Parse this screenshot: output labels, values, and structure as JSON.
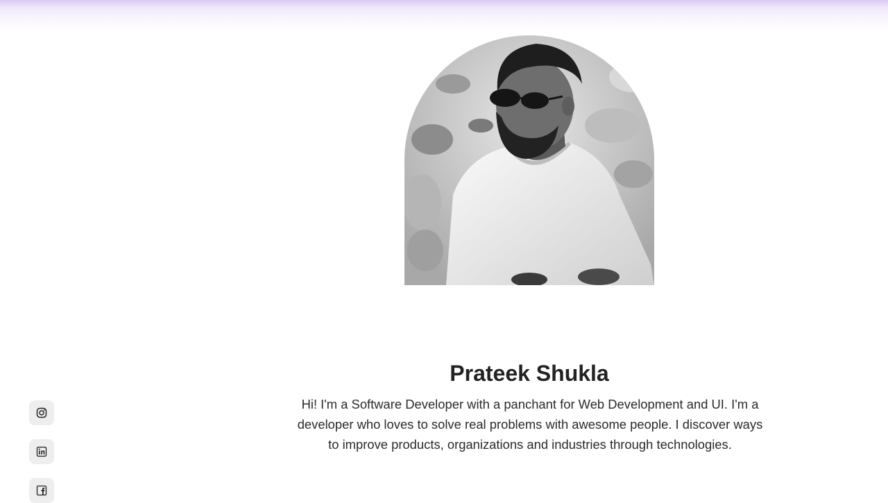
{
  "profile": {
    "name": "Prateek Shukla",
    "bio": "Hi! I'm a Software Developer with a panchant for Web Development and UI. I'm a developer who loves to solve real problems with awesome people. I discover ways to improve products, organizations and industries through technologies.",
    "photo_icon": "profile-photo"
  },
  "social_links": [
    {
      "icon": "instagram-icon"
    },
    {
      "icon": "linkedin-icon"
    },
    {
      "icon": "facebook-icon"
    }
  ],
  "colors": {
    "top_glow": "#d9c9f3",
    "text": "#222222",
    "social_bg": "#eeeeee"
  }
}
